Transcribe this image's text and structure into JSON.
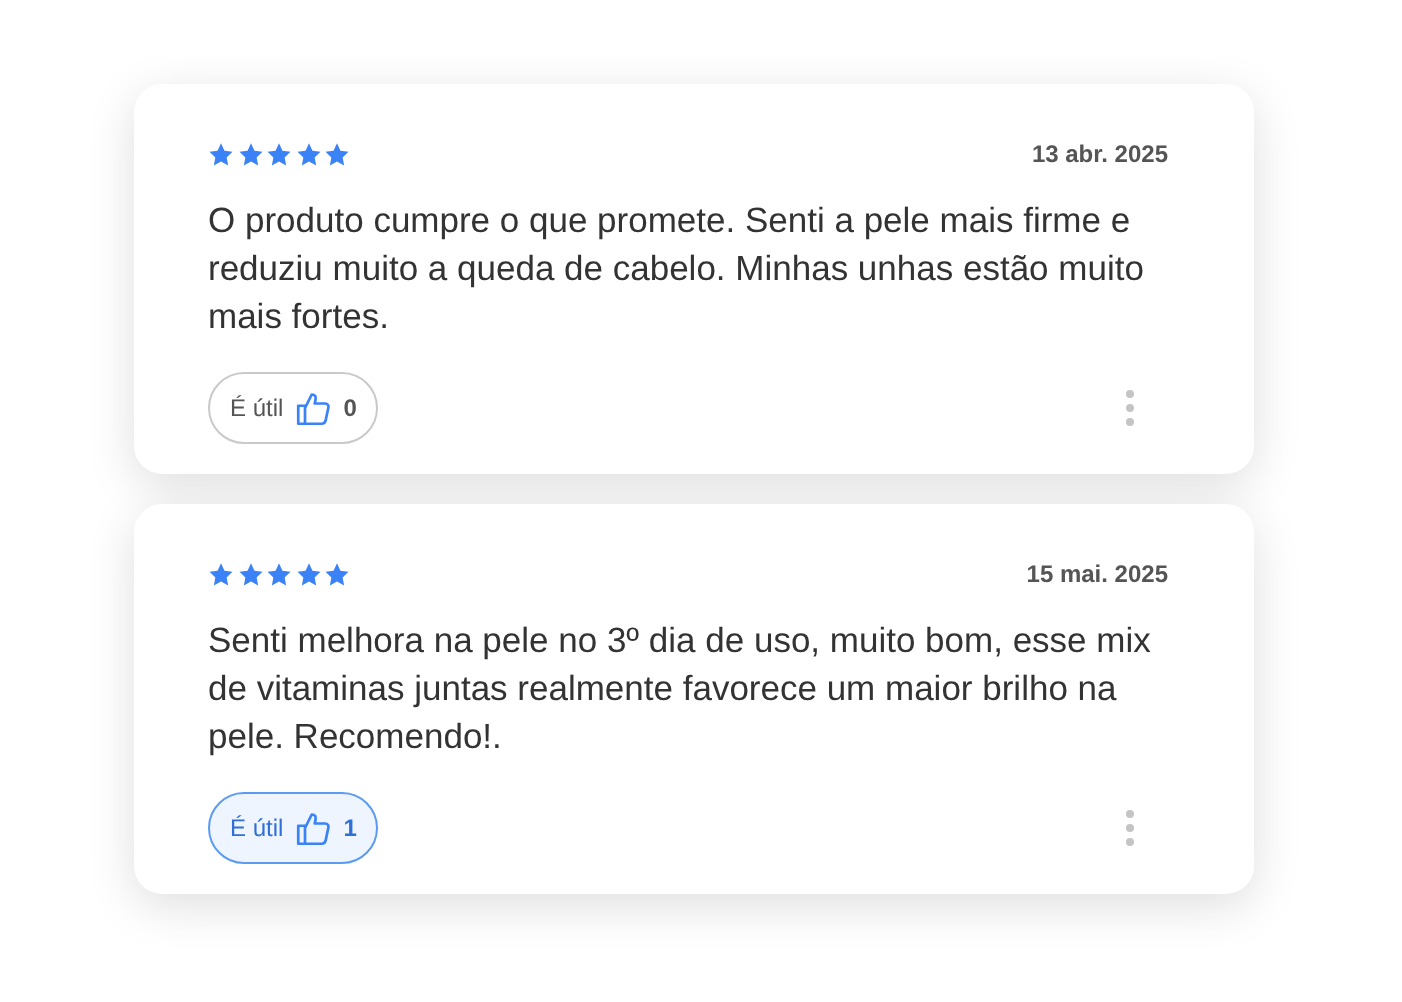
{
  "reviews": [
    {
      "stars": 5,
      "date": "13 abr. 2025",
      "text": "O produto cumpre o que promete. Senti a pele mais firme e reduziu muito a queda de cabelo. Minhas unhas estão muito mais fortes.",
      "helpful": {
        "label": "É útil",
        "count": "0",
        "selected": false
      }
    },
    {
      "stars": 5,
      "date": "15 mai. 2025",
      "text": "Senti melhora na pele no 3º dia de uso, muito bom, esse mix de vitaminas juntas realmente favorece um maior brilho na pele. Recomendo!.",
      "helpful": {
        "label": "É útil",
        "count": "1",
        "selected": true
      }
    }
  ]
}
